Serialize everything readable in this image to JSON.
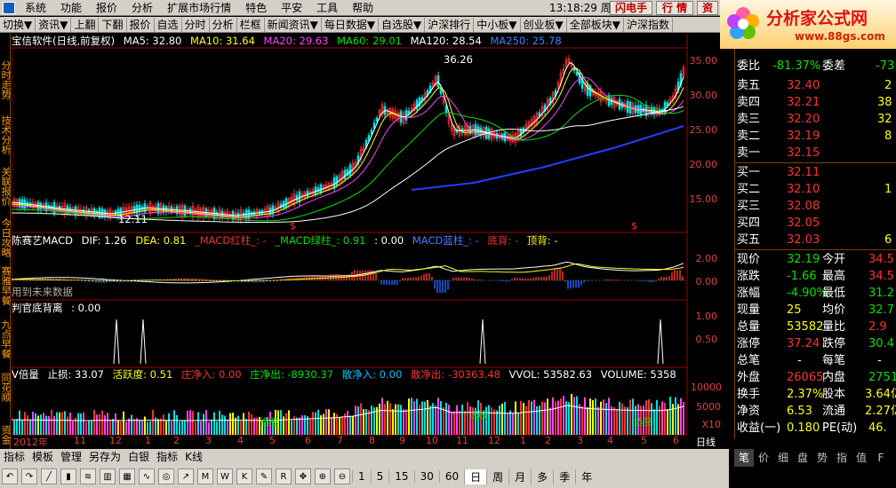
{
  "menubar": {
    "items": [
      "系统",
      "功能",
      "报价",
      "分析",
      "扩展市场行情",
      "特色",
      "平安",
      "工具",
      "帮助"
    ],
    "clock": "13:18:29 周六",
    "flash_btn": "闪电手",
    "hq_btn": "行 情",
    "zx_btn": "资"
  },
  "toolbar": {
    "items": [
      "切换▼",
      "资讯▼",
      "上翻",
      "下翻",
      "报价",
      "自选",
      "分时",
      "分析",
      "栏框",
      "新闻资讯▼",
      "每日数据▼",
      "自选股▼",
      "沪深排行",
      "中小板▼",
      "创业板▼",
      "全部板块▼",
      "沪深指数"
    ]
  },
  "logo": {
    "name": "分析家公式网",
    "url": "www.88gs.com"
  },
  "leftbar": {
    "tabs": [
      "分时走势",
      "技术分析",
      "关联报价",
      "今日攻略",
      "赛雅早餐",
      "九点早餐",
      "同花顺",
      "资金流"
    ]
  },
  "main_header": {
    "stock": "宝信软件(日线,前复权)",
    "ma5": "MA5: 32.80",
    "ma10": "MA10: 31.64",
    "ma20": "MA20: 29.63",
    "ma60": "MA60: 29.01",
    "ma120": "MA120: 28.54",
    "ma250": "MA250: 25.78",
    "peak_label": "36.26",
    "low_label": "12.11",
    "y_ticks": [
      "35.00",
      "30.00",
      "25.00",
      "20.00",
      "15.00"
    ]
  },
  "macd_header": {
    "name": "陈赛艺MACD",
    "dif": "DIF: 1.26",
    "dea": "DEA: 0.81",
    "red": "_MACD红柱_: -",
    "green": "_MACD绿柱_: 0.91",
    "zero": ": 0.00",
    "blue": "MACD蓝柱_: -",
    "dibei": "底背: -",
    "dingbei": "顶背: -",
    "future": "用到未来数据",
    "y_ticks": [
      "2.00",
      "0.00"
    ]
  },
  "judge_header": {
    "name": "判官底背离",
    "value": ": 0.00",
    "y_ticks": [
      "1.00",
      "0.50"
    ]
  },
  "vol_header": {
    "name": "V倍量",
    "stop": "止损: 33.07",
    "active": "活跃度: 0.51",
    "zj_in": "庄净入: 0.00",
    "zj_out": "庄净出: -8930.37",
    "sj_in": "散净入: 0.00",
    "sj_out": "散净出: -30363.48",
    "vvol": "VVOL: 53582.63",
    "volume": "VOLUME: 5358",
    "y_ticks": [
      "10000",
      "5000",
      "X10"
    ],
    "xuangu": "选股"
  },
  "dates": [
    "2012年",
    "11",
    "12",
    "1",
    "2",
    "3",
    "4",
    "5",
    "6",
    "7",
    "8",
    "9",
    "10",
    "11",
    "12",
    "1",
    "2",
    "3",
    "4",
    "5",
    "6"
  ],
  "right_day": "日线",
  "bottom": {
    "row1": [
      "指标",
      "模板",
      "管理",
      "另存为",
      "白银",
      "指标",
      "K线"
    ],
    "periods": [
      "1",
      "5",
      "15",
      "30",
      "60",
      "日",
      "周",
      "月",
      "多",
      "季",
      "年"
    ]
  },
  "quote": {
    "wb_label": "委比",
    "wb": "-81.37%",
    "wc_label": "委差",
    "wc": "-73",
    "sell": [
      {
        "label": "卖五",
        "price": "32.40",
        "vol": "2"
      },
      {
        "label": "卖四",
        "price": "32.21",
        "vol": "38"
      },
      {
        "label": "卖三",
        "price": "32.20",
        "vol": "32"
      },
      {
        "label": "卖二",
        "price": "32.19",
        "vol": "8"
      },
      {
        "label": "卖一",
        "price": "32.15",
        "vol": ""
      }
    ],
    "buy": [
      {
        "label": "买一",
        "price": "32.11",
        "vol": ""
      },
      {
        "label": "买二",
        "price": "32.10",
        "vol": "1"
      },
      {
        "label": "买三",
        "price": "32.08",
        "vol": ""
      },
      {
        "label": "买四",
        "price": "32.05",
        "vol": ""
      },
      {
        "label": "买五",
        "price": "32.03",
        "vol": "6"
      }
    ],
    "stats": [
      {
        "l1": "现价",
        "v1": "32.19",
        "l2": "今开",
        "v2": "34.5"
      },
      {
        "l1": "涨跌",
        "v1": "-1.66",
        "l2": "最高",
        "v2": "34.5"
      },
      {
        "l1": "涨幅",
        "v1": "-4.90%",
        "l2": "最低",
        "v2": "31.2"
      },
      {
        "l1": "现量",
        "v1": "25",
        "l2": "均价",
        "v2": "32.7"
      },
      {
        "l1": "总量",
        "v1": "53582",
        "l2": "量比",
        "v2": "2.9"
      },
      {
        "l1": "涨停",
        "v1": "37.24",
        "l2": "跌停",
        "v2": "30.4"
      },
      {
        "l1": "总笔",
        "v1": "-",
        "l2": "每笔",
        "v2": "-"
      },
      {
        "l1": "外盘",
        "v1": "26065",
        "l2": "内盘",
        "v2": "2751"
      },
      {
        "l1": "换手",
        "v1": "2.37%",
        "l2": "股本",
        "v2": "3.64亿"
      },
      {
        "l1": "净资",
        "v1": "6.53",
        "l2": "流通",
        "v2": "2.27亿"
      },
      {
        "l1": "收益(一)",
        "v1": "0.180",
        "l2": "PE(动)",
        "v2": "46."
      }
    ],
    "tabs": [
      "笔",
      "价",
      "细",
      "盘",
      "势",
      "指",
      "值",
      "F"
    ]
  }
}
